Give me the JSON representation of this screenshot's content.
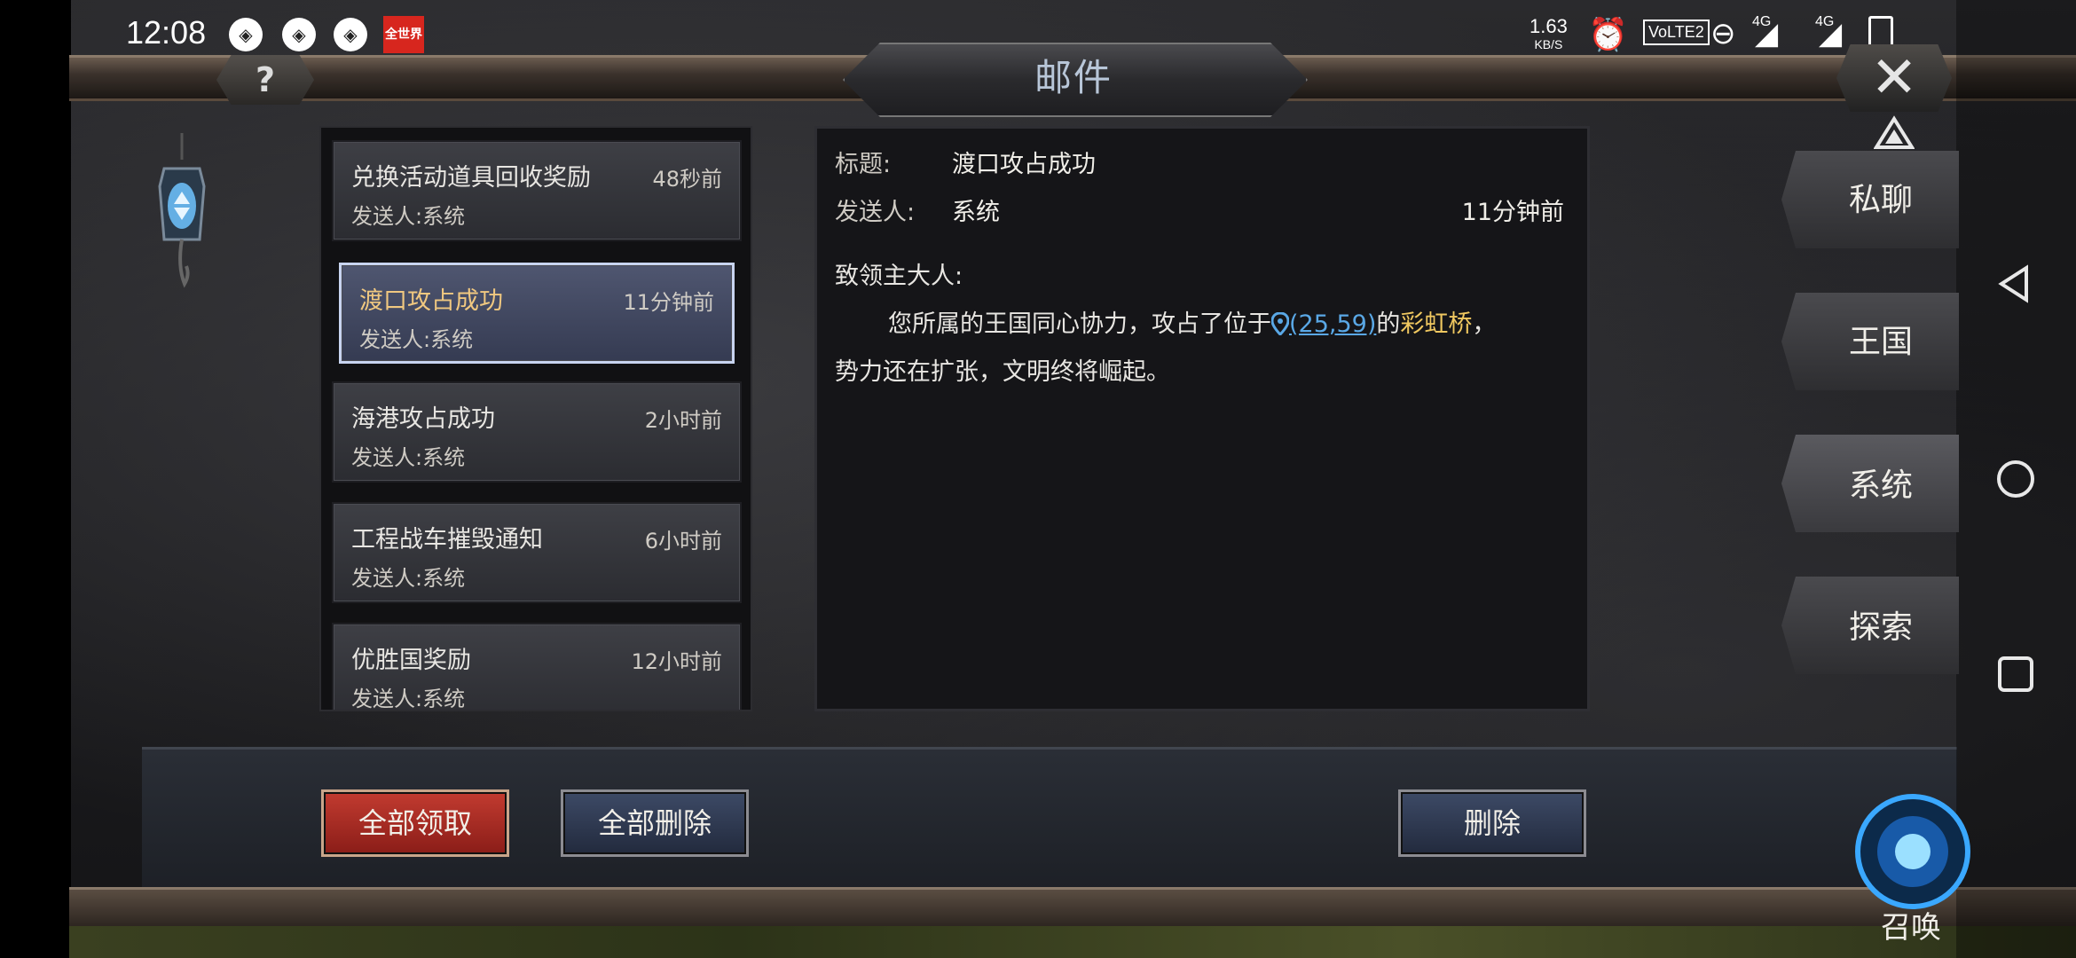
{
  "status_bar": {
    "time": "12:08",
    "news_icon_text": "全世界",
    "net_speed_value": "1.63",
    "net_speed_unit": "KB/S",
    "volte": "VoLTE2",
    "signal1": "4G",
    "signal2": "4G"
  },
  "header": {
    "title": "邮件",
    "help_label": "?",
    "close_label": "✕"
  },
  "mail_list": [
    {
      "title": "兑换活动道具回收奖励",
      "time": "48秒前",
      "sender": "发送人:系统"
    },
    {
      "title": "渡口攻占成功",
      "time": "11分钟前",
      "sender": "发送人:系统"
    },
    {
      "title": "海港攻占成功",
      "time": "2小时前",
      "sender": "发送人:系统"
    },
    {
      "title": "工程战车摧毁通知",
      "time": "6小时前",
      "sender": "发送人:系统"
    },
    {
      "title": "优胜国奖励",
      "time": "12小时前",
      "sender": "发送人:系统"
    }
  ],
  "selected_index": 1,
  "detail": {
    "title_label": "标题:",
    "title_value": "渡口攻占成功",
    "sender_label": "发送人:",
    "sender_value": "系统",
    "time": "11分钟前",
    "greeting": "致领主大人:",
    "body_prefix": "您所属的王国同心协力，攻占了位于",
    "coords": "(25,59)",
    "body_mid": "的",
    "place": "彩虹桥",
    "body_suffix": "，",
    "body_line2": "势力还在扩张，文明终将崛起。"
  },
  "buttons": {
    "claim_all": "全部领取",
    "delete_all": "全部删除",
    "delete": "删除"
  },
  "tabs": [
    {
      "label": "私聊"
    },
    {
      "label": "王国"
    },
    {
      "label": "系统"
    },
    {
      "label": "探索"
    }
  ],
  "summon_label": "召唤"
}
